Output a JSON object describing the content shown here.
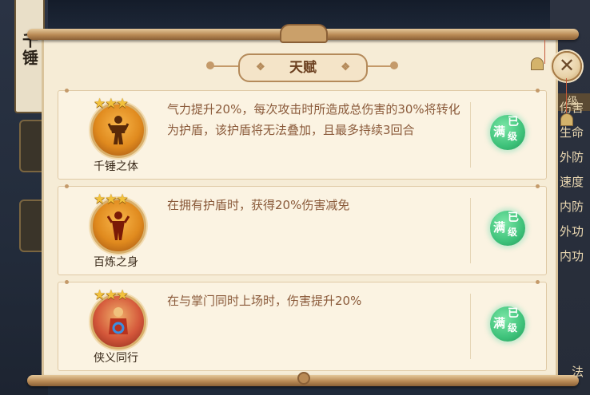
{
  "background": {
    "left_banner": "千锤",
    "right_level": "级",
    "right_items": [
      "伤害",
      "生命",
      "外防",
      "速度",
      "内防",
      "外功",
      "内功"
    ],
    "right_bottom": "法"
  },
  "dialog": {
    "title": "天赋",
    "close_glyph": "✕",
    "title_ornament": "❖"
  },
  "talents": [
    {
      "name": "千锤之体",
      "stars": "★★★",
      "description": "气力提升20%，每次攻击时所造成总伤害的30%将转化为护盾，该护盾将无法叠加，且最多持续3回合",
      "badge": {
        "full": "满",
        "already": "已",
        "level": "级"
      },
      "icon": "golden-warrior-icon"
    },
    {
      "name": "百炼之身",
      "stars": "★★★",
      "description": "在拥有护盾时，获得20%伤害减免",
      "badge": {
        "full": "满",
        "already": "已",
        "level": "级"
      },
      "icon": "flame-warrior-icon"
    },
    {
      "name": "侠义同行",
      "stars": "★★★",
      "description": "在与掌门同时上场时，伤害提升20%",
      "badge": {
        "full": "满",
        "already": "已",
        "level": "级"
      },
      "icon": "blue-aura-warrior-icon"
    }
  ],
  "colors": {
    "panel": "#f6ecd6",
    "description_text": "#8a5a3a",
    "badge_green": "#3ec27a",
    "star_gold": "#f3c23c"
  }
}
